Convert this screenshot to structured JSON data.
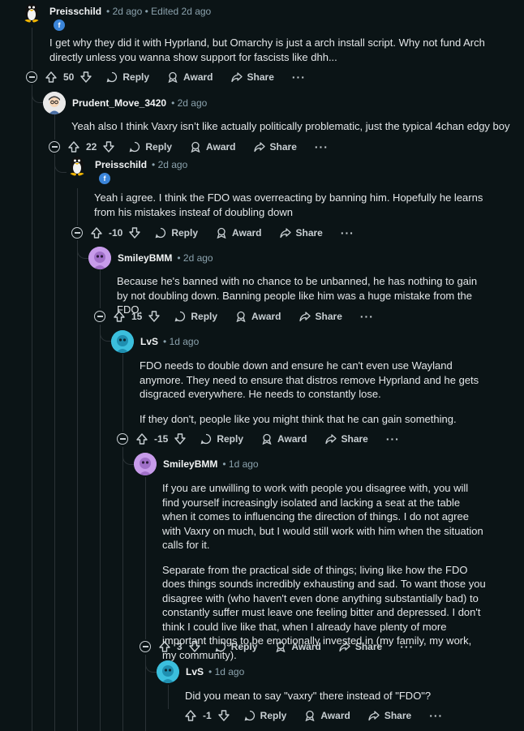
{
  "comments": [
    {
      "user": "Preisschild",
      "time": "2d ago",
      "edited": "Edited 2d ago",
      "body": [
        "I get why they did it with Hyprland, but Omarchy is just a arch install script. Why not fund Arch directly unless you wanna show support for fascists like dhh..."
      ],
      "votes": "50"
    },
    {
      "user": "Prudent_Move_3420",
      "time": "2d ago",
      "body": [
        "Yeah also I think Vaxry isn’t like actually politically problematic, just the typical 4chan edgy boy"
      ],
      "votes": "22"
    },
    {
      "user": "Preisschild",
      "time": "2d ago",
      "body": [
        "Yeah i agree. I think the FDO was overreacting by banning him. Hopefully he learns from his mistakes insteaf of doubling down"
      ],
      "votes": "-10"
    },
    {
      "user": "SmileyBMM",
      "time": "2d ago",
      "body": [
        "Because he's banned with no chance to be unbanned, he has nothing to gain by not doubling down. Banning people like him was a huge mistake from the FDO."
      ],
      "votes": "15"
    },
    {
      "user": "LvS",
      "time": "1d ago",
      "body": [
        "FDO needs to double down and ensure he can't even use Wayland anymore. They need to ensure that distros remove Hyprland and he gets disgraced everywhere. He needs to constantly lose.",
        "If they don't, people like you might think that he can gain something."
      ],
      "votes": "-15"
    },
    {
      "user": "SmileyBMM",
      "time": "1d ago",
      "body": [
        "If you are unwilling to work with people you disagree with, you will find yourself increasingly isolated and lacking a seat at the table when it comes to influencing the direction of things. I do not agree with Vaxry on much, but I would still work with him when the situation calls for it.",
        "Separate from the practical side of things; living like how the FDO does things sounds incredibly exhausting and sad. To want those you disagree with (who haven't even done anything substantially bad) to constantly suffer must leave one feeling bitter and depressed. I don't think I could live like that, when I already have plenty of more important things to be emotionally invested in (my family, my work, my community)."
      ],
      "votes": "3"
    },
    {
      "user": "LvS",
      "time": "1d ago",
      "body": [
        "Did you mean to say \"vaxry\" there instead of \"FDO\"?"
      ],
      "votes": "-1"
    }
  ],
  "actions": {
    "reply": "Reply",
    "award": "Award",
    "share": "Share",
    "more": "···"
  },
  "colors": {
    "background": "#0b1416",
    "thread": "#2a3236",
    "flair": "#3b85d9"
  }
}
